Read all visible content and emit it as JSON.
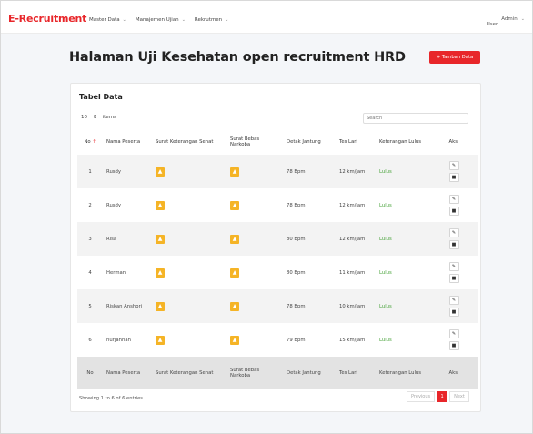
{
  "navbar": {
    "brand": "E-Recruitment",
    "menu": [
      {
        "label": "Master Data"
      },
      {
        "label": "Manajemen Ujian"
      },
      {
        "label": "Rekrutmen"
      }
    ],
    "user_name": "Admin",
    "user_role": "User"
  },
  "page": {
    "title": "Halaman Uji Kesehatan open recruitment HRD",
    "add_button": "+ Tambah Data"
  },
  "card": {
    "title": "Tabel Data",
    "length_value": "10",
    "length_label": "items",
    "search_placeholder": "Search"
  },
  "table": {
    "columns": [
      "No",
      "Nama Peserta",
      "Surat Keterangan Sehat",
      "Surat Bebas Narkoba",
      "Detak Jantung",
      "Tes Lari",
      "Keterangan Lulus",
      "Aksi"
    ],
    "rows": [
      {
        "no": "1",
        "nama": "Rusdy",
        "detak": "78 Bpm",
        "lari": "12 km/jam",
        "ket": "Lulus"
      },
      {
        "no": "2",
        "nama": "Rusdy",
        "detak": "78 Bpm",
        "lari": "12 km/jam",
        "ket": "Lulus"
      },
      {
        "no": "3",
        "nama": "Risa",
        "detak": "80 Bpm",
        "lari": "12 km/jam",
        "ket": "Lulus"
      },
      {
        "no": "4",
        "nama": "Herman",
        "detak": "80 Bpm",
        "lari": "11 km/jam",
        "ket": "Lulus"
      },
      {
        "no": "5",
        "nama": "Riskan Anshori",
        "detak": "78 Bpm",
        "lari": "10 km/jam",
        "ket": "Lulus"
      },
      {
        "no": "6",
        "nama": "nurjannah",
        "detak": "79 Bpm",
        "lari": "15 km/jam",
        "ket": "Lulus"
      }
    ]
  },
  "footer": {
    "showing": "Showing 1 to 6 of 6 entries",
    "previous": "Previous",
    "page": "1",
    "next": "Next"
  },
  "colors": {
    "accent": "#e8262a",
    "warning": "#f5b426",
    "success": "#48a33a"
  }
}
